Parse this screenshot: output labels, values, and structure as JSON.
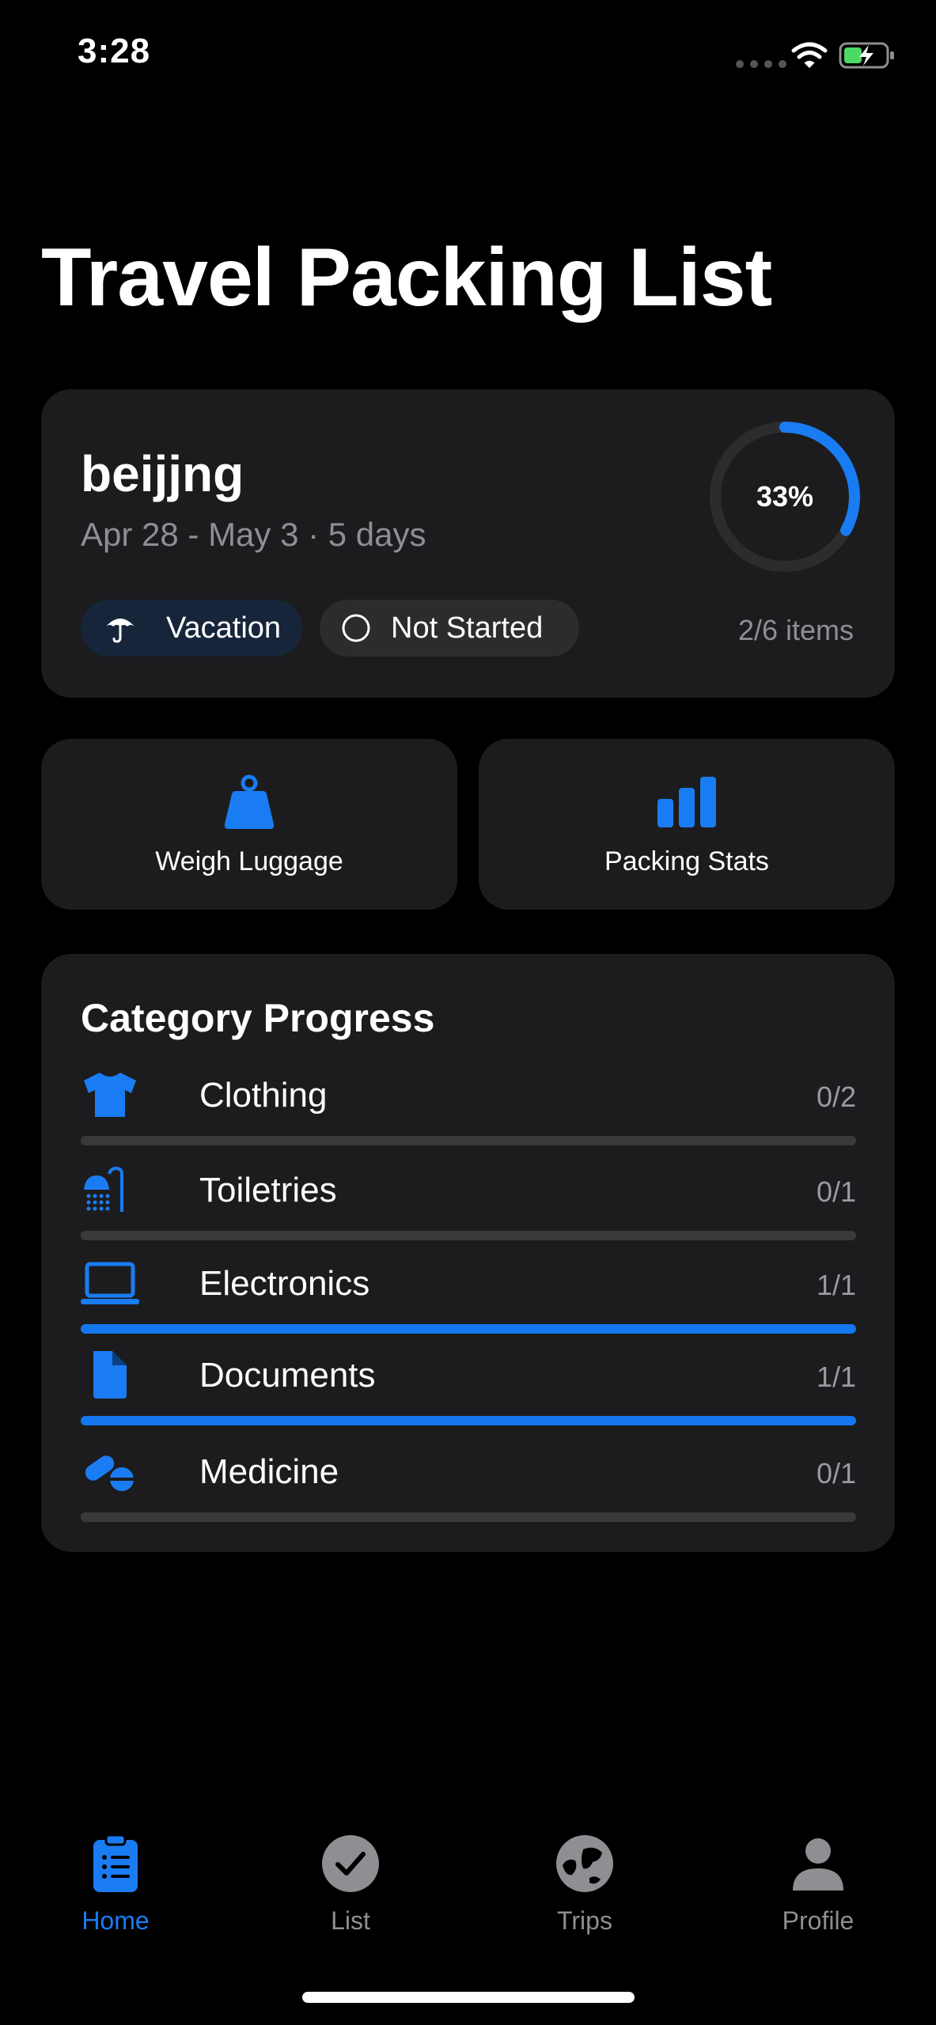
{
  "status": {
    "time": "3:28"
  },
  "page": {
    "title": "Travel Packing List"
  },
  "trip": {
    "name": "beijjng",
    "dates": "Apr 28 - May 3 · 5 days",
    "type_label": "Vacation",
    "status_label": "Not Started",
    "progress_percent": 33,
    "progress_label": "33%",
    "items_label": "2/6 items"
  },
  "actions": {
    "weigh_label": "Weigh Luggage",
    "stats_label": "Packing Stats"
  },
  "categories": {
    "title": "Category Progress",
    "items": [
      {
        "name": "Clothing",
        "count": "0/2",
        "fraction": 0,
        "icon": "tshirt-icon"
      },
      {
        "name": "Toiletries",
        "count": "0/1",
        "fraction": 0,
        "icon": "shower-icon"
      },
      {
        "name": "Electronics",
        "count": "1/1",
        "fraction": 1,
        "icon": "laptop-icon"
      },
      {
        "name": "Documents",
        "count": "1/1",
        "fraction": 1,
        "icon": "document-icon"
      },
      {
        "name": "Medicine",
        "count": "0/1",
        "fraction": 0,
        "icon": "pills-icon"
      }
    ]
  },
  "tabs": [
    {
      "label": "Home",
      "icon": "clipboard-icon",
      "active": true
    },
    {
      "label": "List",
      "icon": "checkmark-circle-icon",
      "active": false
    },
    {
      "label": "Trips",
      "icon": "globe-icon",
      "active": false
    },
    {
      "label": "Profile",
      "icon": "person-icon",
      "active": false
    }
  ],
  "colors": {
    "accent": "#1a7cf2",
    "card": "#1c1c1e",
    "background": "#000000",
    "muted": "#8e8e93"
  }
}
